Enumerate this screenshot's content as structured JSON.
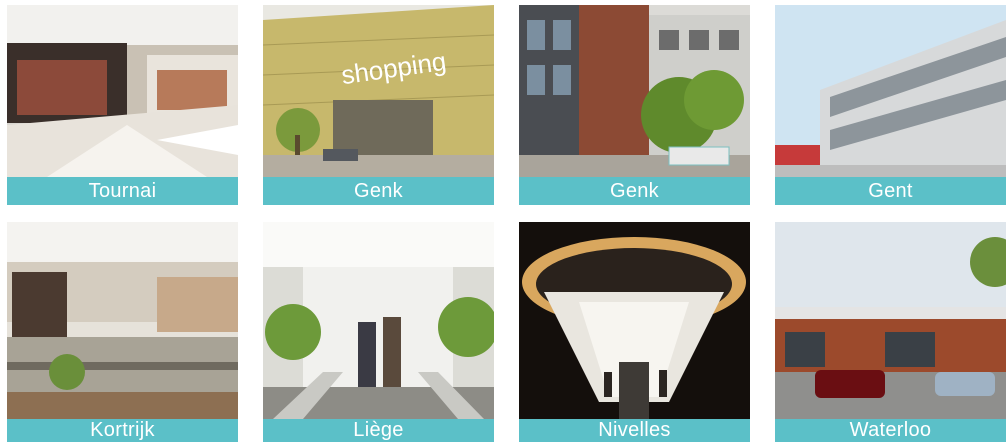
{
  "tiles": [
    {
      "caption": "Tournai"
    },
    {
      "caption": "Genk",
      "sign": "shopping"
    },
    {
      "caption": "Genk"
    },
    {
      "caption": "Gent"
    },
    {
      "caption": "Kortrijk"
    },
    {
      "caption": "Liège"
    },
    {
      "caption": "Nivelles"
    },
    {
      "caption": "Waterloo"
    }
  ],
  "colors": {
    "caption_bg": "#5bc0c8",
    "caption_text": "#ffffff"
  }
}
